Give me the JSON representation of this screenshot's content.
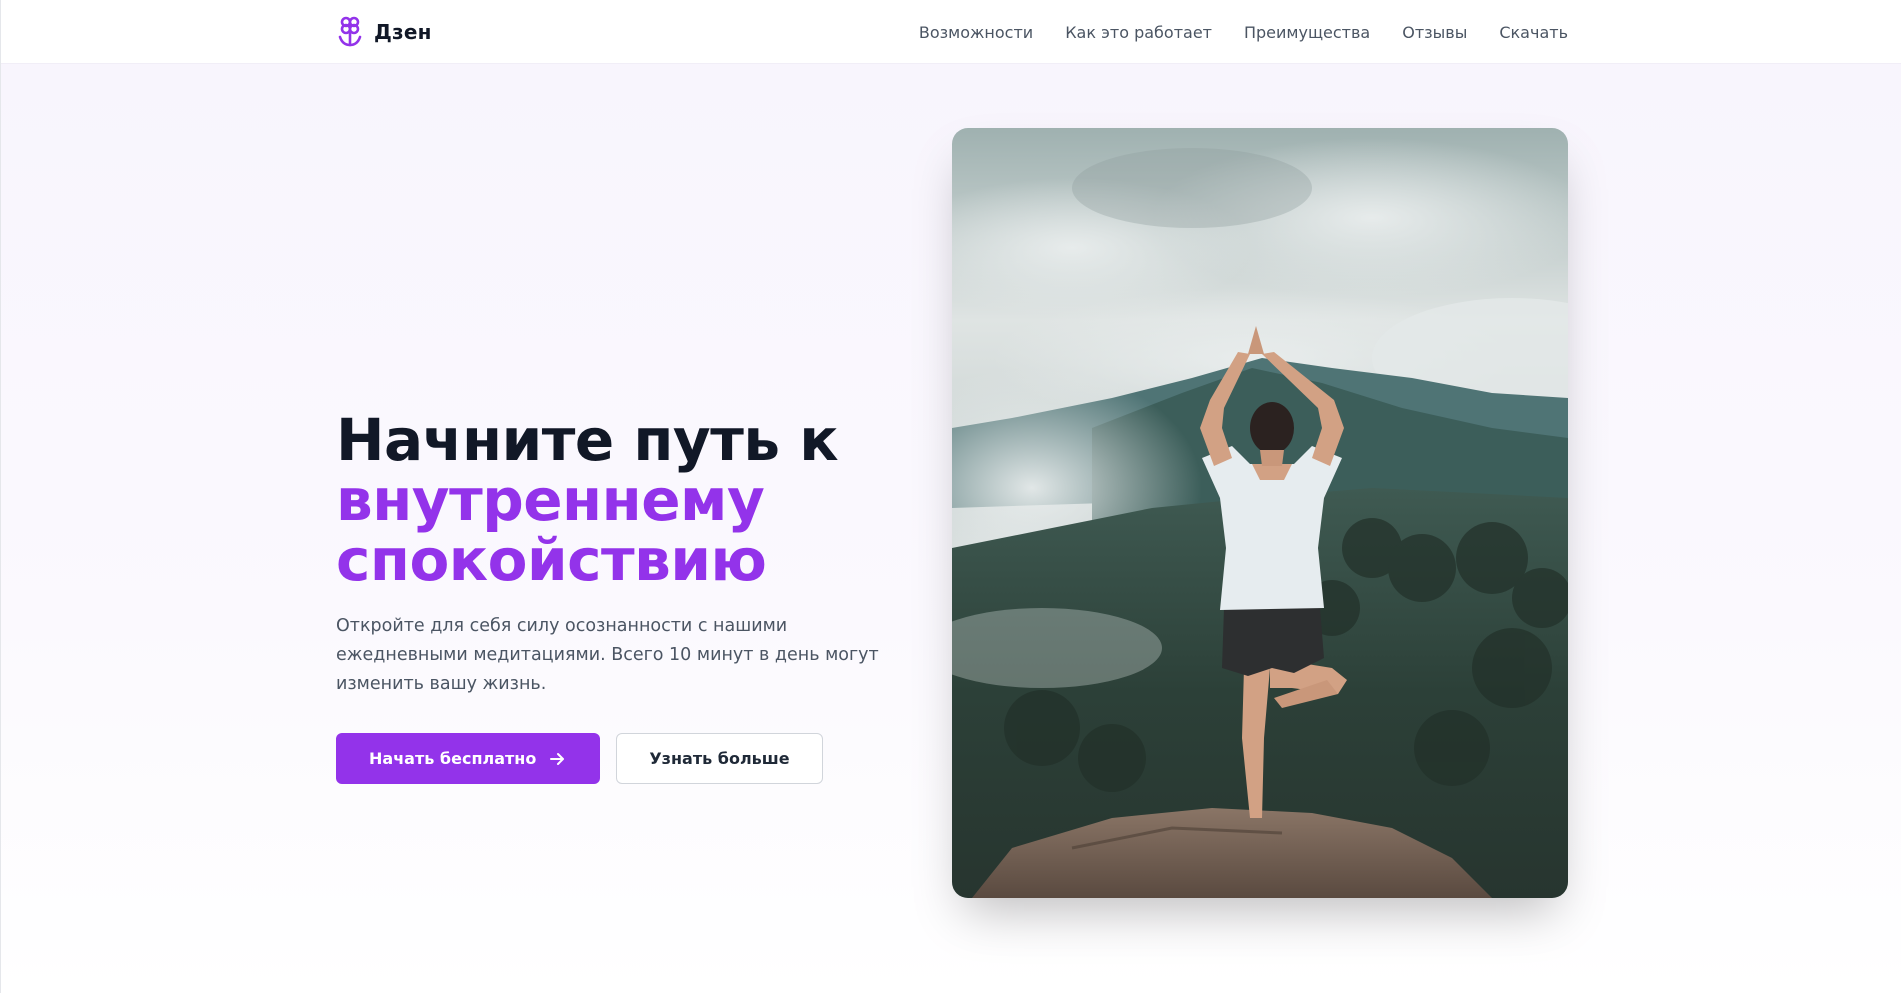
{
  "brand": {
    "name": "Дзен",
    "icon": "lotus-flower-icon",
    "color": "#9333ea"
  },
  "nav": {
    "items": [
      {
        "label": "Возможности"
      },
      {
        "label": "Как это работает"
      },
      {
        "label": "Преимущества"
      },
      {
        "label": "Отзывы"
      },
      {
        "label": "Скачать"
      }
    ]
  },
  "hero": {
    "title_line1": "Начните путь к",
    "title_line2": "внутреннему",
    "title_line3": "спокойствию",
    "description": "Откройте для себя силу осознанности с нашими ежедневными медитациями. Всего 10 минут в день могут изменить вашу жизнь.",
    "primary_button": "Начать бесплатно",
    "primary_button_icon": "arrow-right-icon",
    "secondary_button": "Узнать больше",
    "image_subject": "woman-yoga-tree-pose-mountain-photo"
  },
  "colors": {
    "accent": "#9333ea",
    "heading": "#111827",
    "body_text": "#4b5563",
    "hero_background": "#f8f5fd"
  }
}
